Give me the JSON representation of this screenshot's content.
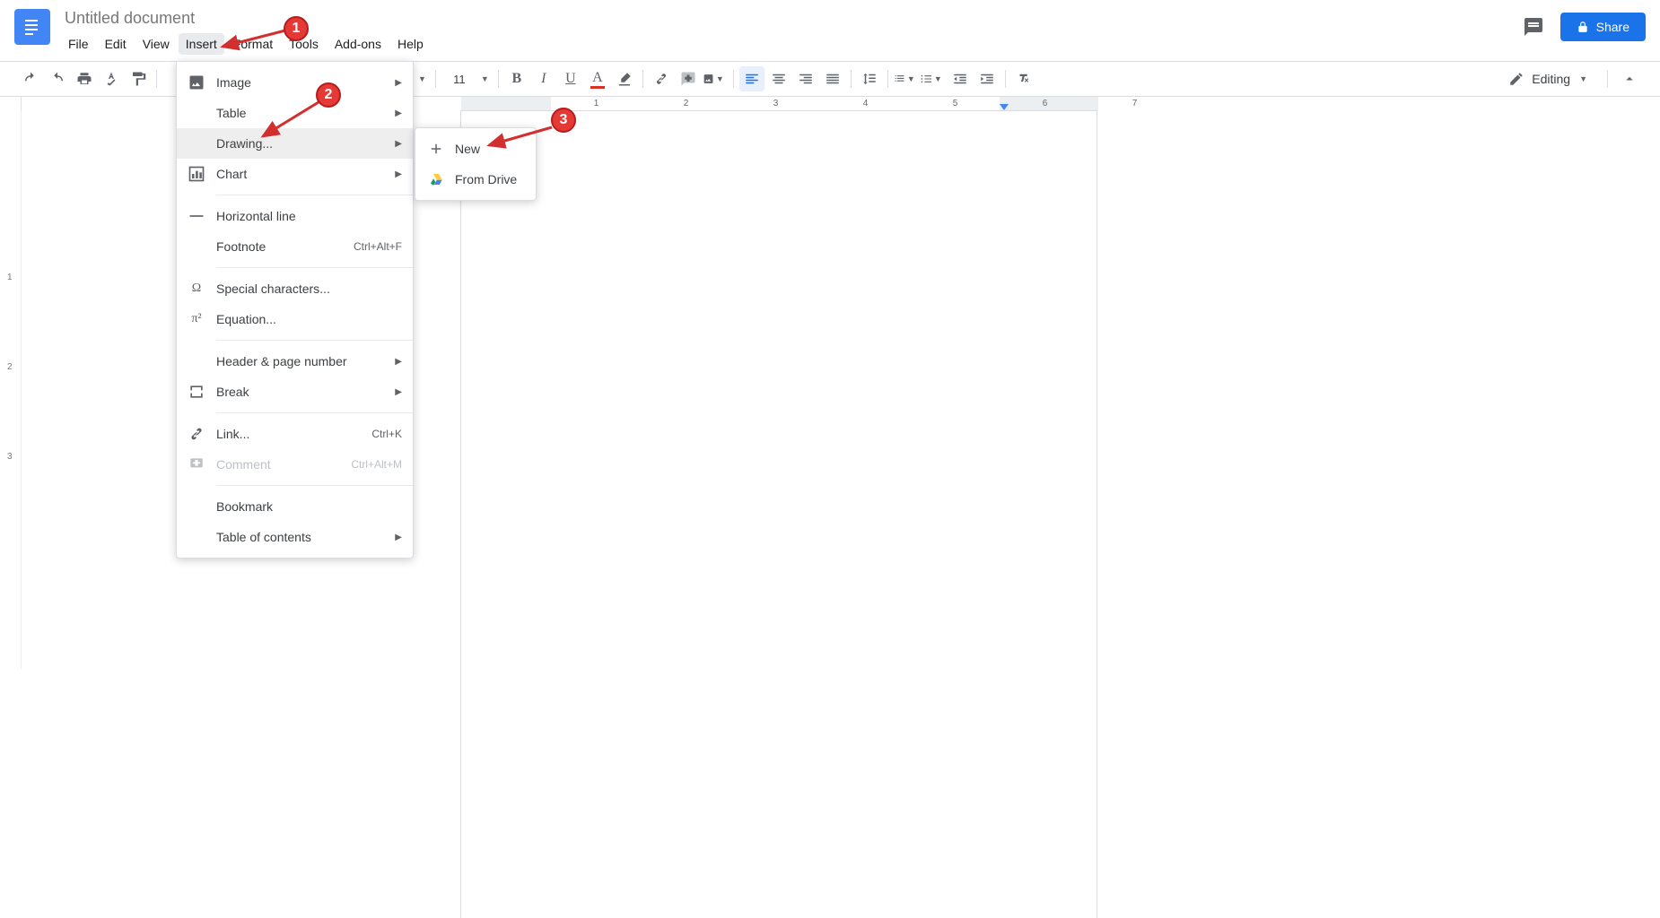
{
  "document": {
    "title": "Untitled document"
  },
  "menubar": {
    "file": "File",
    "edit": "Edit",
    "view": "View",
    "insert": "Insert",
    "format": "Format",
    "tools": "Tools",
    "addons": "Add-ons",
    "help": "Help"
  },
  "header": {
    "share": "Share"
  },
  "toolbar": {
    "font_size": "11",
    "editing": "Editing"
  },
  "insert_menu": {
    "image": "Image",
    "table": "Table",
    "drawing": "Drawing...",
    "chart": "Chart",
    "horizontal_line": "Horizontal line",
    "footnote": "Footnote",
    "footnote_shortcut": "Ctrl+Alt+F",
    "special_chars": "Special characters...",
    "equation": "Equation...",
    "header_page_number": "Header & page number",
    "break": "Break",
    "link": "Link...",
    "link_shortcut": "Ctrl+K",
    "comment": "Comment",
    "comment_shortcut": "Ctrl+Alt+M",
    "bookmark": "Bookmark",
    "toc": "Table of contents"
  },
  "drawing_submenu": {
    "new": "New",
    "from_drive": "From Drive"
  },
  "callouts": {
    "c1": "1",
    "c2": "2",
    "c3": "3"
  },
  "ruler": {
    "marks": [
      "1",
      "2",
      "3",
      "4",
      "5",
      "6",
      "7"
    ]
  }
}
